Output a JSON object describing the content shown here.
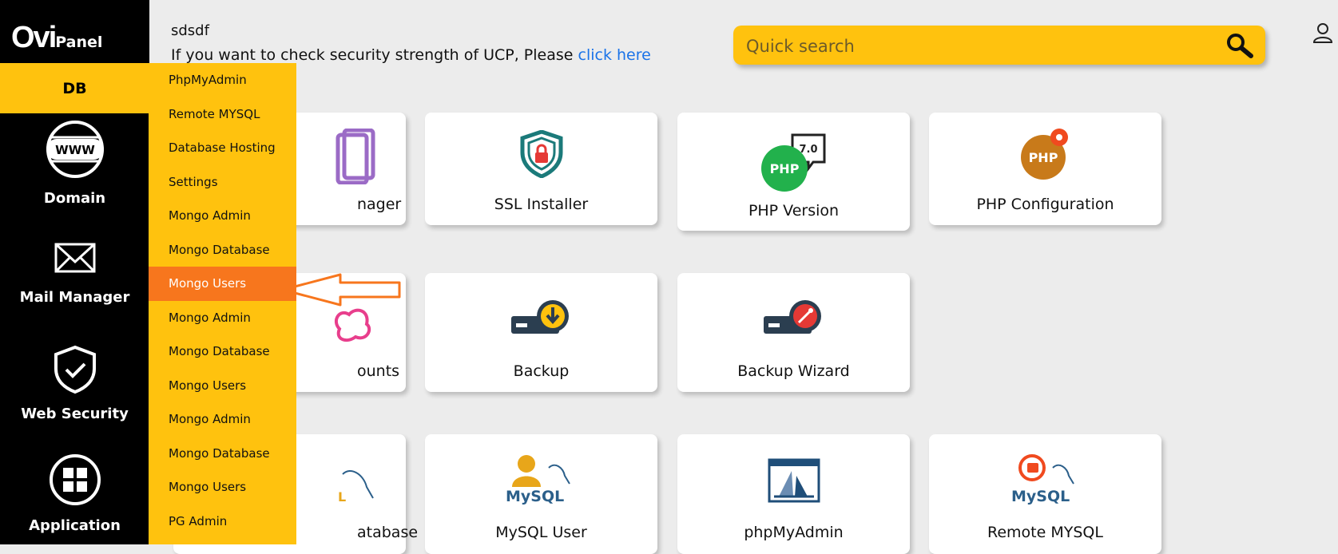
{
  "logo": {
    "big": "Ovi",
    "small": "Panel"
  },
  "sidebar": {
    "active": "DB",
    "items": [
      {
        "label": "Domain",
        "icon": "www-globe-icon"
      },
      {
        "label": "Mail Manager",
        "icon": "envelope-icon"
      },
      {
        "label": "Web Security",
        "icon": "shield-check-icon"
      },
      {
        "label": "Application",
        "icon": "grid-apps-icon"
      }
    ]
  },
  "dropdown": {
    "items": [
      "PhpMyAdmin",
      "Remote MYSQL",
      "Database Hosting",
      "Settings",
      "Mongo Admin",
      "Mongo Database",
      "Mongo Users",
      "Mongo Admin",
      "Mongo Database",
      "Mongo Users",
      "Mongo Admin",
      "Mongo Database",
      "Mongo Users",
      "PG Admin"
    ],
    "active_index": 6
  },
  "header": {
    "username": "sdsdf",
    "message": "If you want to check security strength of UCP, Please ",
    "link": "click here",
    "search_placeholder": "Quick search"
  },
  "cards": {
    "r1c1": "nager",
    "r1c2": "SSL Installer",
    "r1c3": "PHP Version",
    "r1c4": "PHP Configuration",
    "r2c1": "ounts",
    "r2c2": "Backup",
    "r2c3": "Backup Wizard",
    "r3c1": "atabase",
    "r3c2": "MySQL User",
    "r3c3": "phpMyAdmin",
    "r3c4": "Remote MYSQL"
  },
  "icon_text": {
    "php": "PHP",
    "php_version": "7.0",
    "mysql": "MySQL"
  },
  "colors": {
    "accent": "#ffc20e",
    "active": "#f7761d",
    "link": "#1a73e8"
  }
}
